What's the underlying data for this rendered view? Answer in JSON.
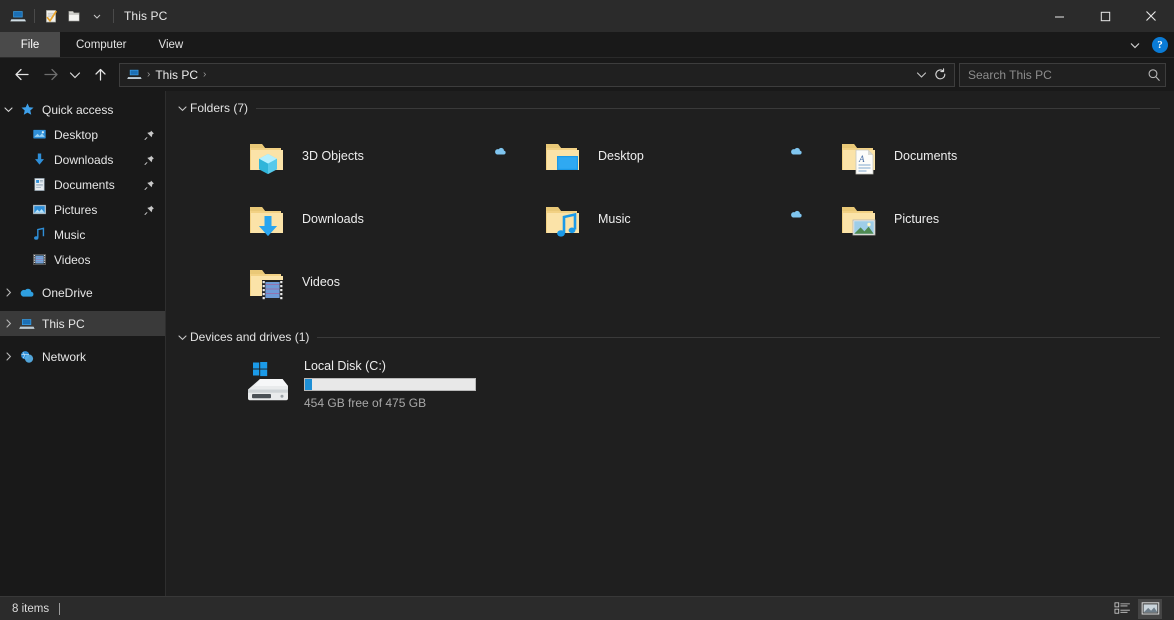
{
  "window": {
    "title": "This PC",
    "quick_access_toolbar": [
      {
        "name": "properties",
        "label": "Properties"
      },
      {
        "name": "new-folder",
        "label": "New folder"
      },
      {
        "name": "customize",
        "label": "Customize Quick Access Toolbar"
      }
    ],
    "controls": {
      "minimize": "—",
      "maximize": "□",
      "close": "✕"
    }
  },
  "ribbon": {
    "tabs": [
      {
        "id": "file",
        "label": "File",
        "active": true
      },
      {
        "id": "computer",
        "label": "Computer",
        "active": false
      },
      {
        "id": "view",
        "label": "View",
        "active": false
      }
    ],
    "collapse_label": "⌄",
    "help_label": "?"
  },
  "addressbar": {
    "back_label": "←",
    "forward_label": "→",
    "recent_label": "⌄",
    "up_label": "↑",
    "breadcrumb": [
      {
        "label": "This PC"
      }
    ],
    "breadcrumb_sep": "›",
    "dropdown_label": "⌄",
    "refresh_label": "↻"
  },
  "search": {
    "placeholder": "Search This PC",
    "value": "",
    "icon": "search-icon"
  },
  "sidebar": {
    "items": [
      {
        "label": "Quick access",
        "icon": "star-icon",
        "level": 1,
        "chevron": "expanded",
        "pinned": false,
        "selected": false
      },
      {
        "label": "Desktop",
        "icon": "desktop-icon",
        "level": 2,
        "chevron": "none",
        "pinned": true,
        "selected": false
      },
      {
        "label": "Downloads",
        "icon": "downloads-icon",
        "level": 2,
        "chevron": "none",
        "pinned": true,
        "selected": false
      },
      {
        "label": "Documents",
        "icon": "documents-icon",
        "level": 2,
        "chevron": "none",
        "pinned": true,
        "selected": false
      },
      {
        "label": "Pictures",
        "icon": "pictures-icon",
        "level": 2,
        "chevron": "none",
        "pinned": true,
        "selected": false
      },
      {
        "label": "Music",
        "icon": "music-icon",
        "level": 2,
        "chevron": "none",
        "pinned": false,
        "selected": false
      },
      {
        "label": "Videos",
        "icon": "videos-icon",
        "level": 2,
        "chevron": "none",
        "pinned": false,
        "selected": false
      },
      {
        "label": "OneDrive",
        "icon": "cloud-icon",
        "level": 1,
        "chevron": "collapsed",
        "pinned": false,
        "selected": false
      },
      {
        "label": "This PC",
        "icon": "pc-icon",
        "level": 1,
        "chevron": "collapsed",
        "pinned": false,
        "selected": true
      },
      {
        "label": "Network",
        "icon": "network-icon",
        "level": 1,
        "chevron": "collapsed",
        "pinned": false,
        "selected": false
      }
    ]
  },
  "content": {
    "groups": [
      {
        "title": "Folders (7)",
        "chevron": "expanded",
        "items": [
          {
            "label": "3D Objects",
            "icon": "folder-3dobjects-icon",
            "cloud": false
          },
          {
            "label": "Desktop",
            "icon": "folder-desktop-icon",
            "cloud": true
          },
          {
            "label": "Documents",
            "icon": "folder-documents-icon",
            "cloud": true
          },
          {
            "label": "Downloads",
            "icon": "folder-downloads-icon",
            "cloud": false
          },
          {
            "label": "Music",
            "icon": "folder-music-icon",
            "cloud": false
          },
          {
            "label": "Pictures",
            "icon": "folder-pictures-icon",
            "cloud": true
          },
          {
            "label": "Videos",
            "icon": "folder-videos-icon",
            "cloud": false
          }
        ]
      },
      {
        "title": "Devices and drives (1)",
        "chevron": "expanded",
        "drives": [
          {
            "name": "Local Disk (C:)",
            "icon": "windows-drive-icon",
            "free_text": "454 GB free of 475 GB",
            "used_percent": 4.4,
            "bar_color": "#1e8fd5"
          }
        ]
      }
    ]
  },
  "statusbar": {
    "item_count": "8 items",
    "views": [
      {
        "name": "details-view",
        "active": false
      },
      {
        "name": "large-icons-view",
        "active": true
      }
    ]
  },
  "colors": {
    "accent": "#0a7bd6",
    "window_bg": "#191919",
    "content_bg": "#1f1f1f",
    "titlebar_bg": "#2b2b2b",
    "selection": "#3a3a3a",
    "folder_yellow": "#f5d98a"
  }
}
